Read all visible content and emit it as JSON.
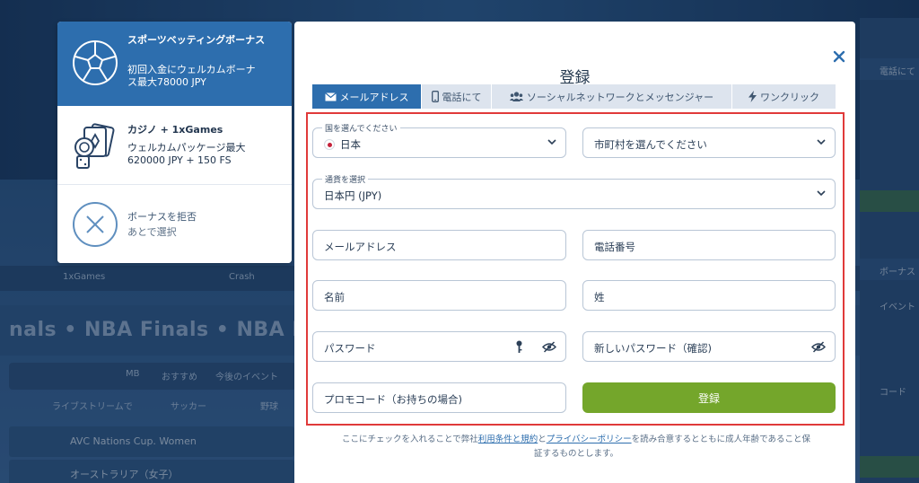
{
  "background": {
    "tabs": [
      "1xGames",
      "Crash"
    ],
    "finals_text": "nals  •  NBA Finals  •  NBA Finals",
    "nav_items": [
      "MB",
      "おすすめ",
      "今後のイベント"
    ],
    "live_items": [
      "ライブストリームで",
      "サッカー",
      "野球"
    ],
    "rows": [
      "AVC Nations Cup. Women",
      "オーストラリア（女子）"
    ],
    "right_texts": [
      "電話にて",
      "ボーナス",
      "イベント",
      "コード"
    ]
  },
  "bonus": {
    "sports": {
      "icon": "soccer-ball-icon",
      "title": "スポーツベッティングボーナス",
      "desc_line1": "初回入金にウェルカムボーナ",
      "desc_line2": "ス最大78000 JPY"
    },
    "casino": {
      "icon": "casino-chips-cards-icon",
      "title": "カジノ + 1xGames",
      "desc_line1": "ウェルカムパッケージ最大",
      "desc_line2": "620000 JPY + 150 FS"
    },
    "reject": {
      "icon": "x-circle-icon",
      "title": "ボーナスを拒否",
      "desc": "あとで選択"
    }
  },
  "modal": {
    "title": "登録",
    "close_icon": "close-icon",
    "tabs": [
      {
        "label": "メールアドレス",
        "icon": "envelope-icon",
        "active": true
      },
      {
        "label": "電話にて",
        "icon": "phone-icon",
        "active": false
      },
      {
        "label": "ソーシャルネットワークとメッセンジャー",
        "icon": "users-icon",
        "active": false
      },
      {
        "label": "ワンクリック",
        "icon": "lightning-icon",
        "active": false
      }
    ],
    "country": {
      "label": "国を選んでください",
      "value": "日本"
    },
    "city": {
      "placeholder": "市町村を選んでください"
    },
    "currency": {
      "label": "通貨を選択",
      "value": "日本円 (JPY)"
    },
    "email": {
      "placeholder": "メールアドレス"
    },
    "phone": {
      "placeholder": "電話番号"
    },
    "first_name": {
      "placeholder": "名前"
    },
    "last_name": {
      "placeholder": "姓"
    },
    "password": {
      "placeholder": "パスワード"
    },
    "password_confirm": {
      "placeholder": "新しいパスワード（確認)"
    },
    "promo": {
      "placeholder": "プロモコード（お持ちの場合)"
    },
    "submit_label": "登録",
    "terms": {
      "part1": "ここにチェックを入れることで弊社",
      "link1": "利用条件と規約",
      "part2": "と",
      "link2": "プライバシーポリシー",
      "part3": "を読み合意するとともに成人年齢であること保",
      "part4": "証するものとします。"
    }
  },
  "colors": {
    "accent": "#2d6eae",
    "submit": "#74a62b",
    "highlight_border": "#e03a3a"
  }
}
